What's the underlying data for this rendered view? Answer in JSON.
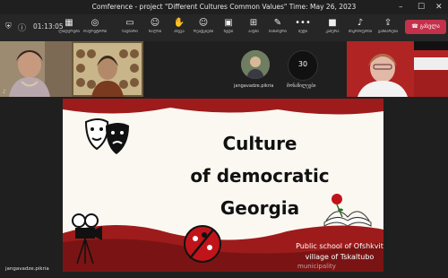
{
  "window": {
    "title": "Comference - project \"Different Cultures Common Values\" Time: May 26, 2023",
    "controls": [
      "–",
      "☐",
      "✕"
    ]
  },
  "toolbar": {
    "timer": "01:13:05",
    "items": [
      {
        "icon": "grid-icon",
        "glyph": "▦",
        "label": "ლიდერები"
      },
      {
        "icon": "compass-icon",
        "glyph": "◎",
        "label": "ოპერეტორი"
      },
      {
        "icon": "chat-icon",
        "glyph": "▭",
        "label": "საუბარი"
      },
      {
        "icon": "people-icon",
        "glyph": "☺",
        "label": "ხალხი"
      },
      {
        "icon": "hand-icon",
        "glyph": "✋",
        "label": "აწევა"
      },
      {
        "icon": "reactions-icon",
        "glyph": "☺",
        "label": "რეაქციები"
      },
      {
        "icon": "view-icon",
        "glyph": "▣",
        "label": "ხედი"
      },
      {
        "icon": "apps-icon",
        "glyph": "⊞",
        "label": "აპები"
      },
      {
        "icon": "notes-icon",
        "glyph": "✎",
        "label": "ჩანაწერი"
      },
      {
        "icon": "more-icon",
        "glyph": "•••",
        "label": "მეტი"
      },
      {
        "icon": "camera-icon",
        "glyph": "■",
        "label": "კამერა"
      },
      {
        "icon": "mic-icon",
        "glyph": "♪",
        "label": "მიკროფონი"
      },
      {
        "icon": "share-icon",
        "glyph": "⇪",
        "label": "გაზიარება"
      }
    ],
    "leave_label": "გასვლა"
  },
  "participants": {
    "tile_initials": "30",
    "name_left": "jangavadze.pikria",
    "name_right": "მონაწილეები"
  },
  "slide": {
    "title_line1": "Culture",
    "title_line2": "of democratic",
    "title_line3": "Georgia",
    "school_line1": "Public school of Ofshkvit",
    "school_line2": "village of Tskaltubo",
    "watermark": "municipality"
  },
  "footer": {
    "presenter_name": "jangavadze.pikria"
  }
}
